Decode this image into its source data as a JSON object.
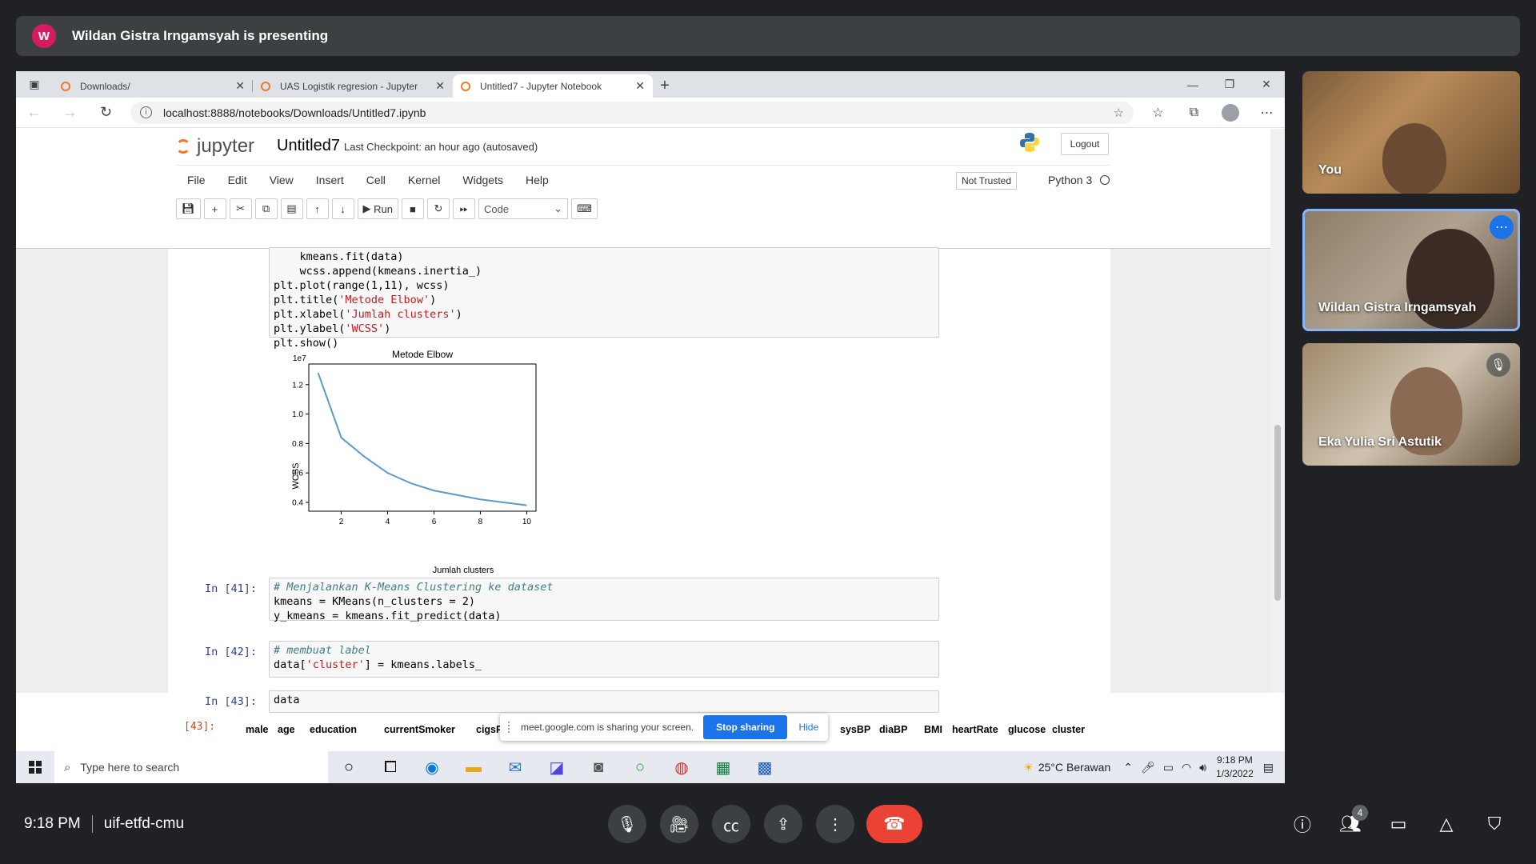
{
  "banner": {
    "avatar_letter": "W",
    "text": "Wildan Gistra Irngamsyah is presenting"
  },
  "browser": {
    "tabs": [
      {
        "label": "Downloads/"
      },
      {
        "label": "UAS Logistik regresion - Jupyter"
      },
      {
        "label": "Untitled7 - Jupyter Notebook"
      }
    ],
    "url": "localhost:8888/notebooks/Downloads/Untitled7.ipynb"
  },
  "jupyter": {
    "logo_text": "jupyter",
    "notebook_name": "Untitled7",
    "checkpoint_label": "Last Checkpoint:",
    "checkpoint_time": "an hour ago",
    "autosave": "(autosaved)",
    "logout": "Logout",
    "menu": [
      "File",
      "Edit",
      "View",
      "Insert",
      "Cell",
      "Kernel",
      "Widgets",
      "Help"
    ],
    "not_trusted": "Not Trusted",
    "kernel": "Python 3",
    "run_label": "Run",
    "cell_type": "Code"
  },
  "cells": {
    "c40_line1": "    kmeans.fit(data)",
    "c40_line2": "    wcss.append(kmeans.inertia_)",
    "c40_line3": "plt.plot(range(1,11), wcss)",
    "c40_line4_a": "plt.title(",
    "c40_line4_s": "'Metode Elbow'",
    "c40_line4_b": ")",
    "c40_line5_a": "plt.xlabel(",
    "c40_line5_s": "'Jumlah clusters'",
    "c40_line5_b": ")",
    "c40_line6_a": "plt.ylabel(",
    "c40_line6_s": "'WCSS'",
    "c40_line6_b": ")",
    "c40_line7": "plt.show()",
    "p41": "In [41]:",
    "c41_comment": "# Menjalankan K-Means Clustering ke dataset",
    "c41_line2": "kmeans = KMeans(n_clusters = 2)",
    "c41_line3": "y_kmeans = kmeans.fit_predict(data)",
    "p42": "In [42]:",
    "c42_comment": "# membuat label",
    "c42_line2_a": "data[",
    "c42_line2_s": "'cluster'",
    "c42_line2_b": "] = kmeans.labels_",
    "p43": "In [43]:",
    "c43_line1": "data",
    "out43": "[43]:"
  },
  "chart_data": {
    "type": "line",
    "title": "Metode Elbow",
    "xlabel": "Jumlah clusters",
    "ylabel": "WCSS",
    "offset_label": "1e7",
    "x": [
      1,
      2,
      3,
      4,
      5,
      6,
      7,
      8,
      9,
      10
    ],
    "y": [
      1.28,
      0.84,
      0.71,
      0.6,
      0.53,
      0.48,
      0.45,
      0.42,
      0.4,
      0.38
    ],
    "xlim": [
      0.6,
      10.4
    ],
    "ylim": [
      0.34,
      1.34
    ],
    "xticks": [
      "2",
      "4",
      "6",
      "8",
      "10"
    ],
    "yticks": [
      "0.4",
      "0.6",
      "0.8",
      "1.0",
      "1.2"
    ],
    "color": "#5b9bc8"
  },
  "table": {
    "columns_left": [
      "male",
      "age",
      "education",
      "currentSmoker",
      "cigsPe"
    ],
    "columns_right": [
      "sysBP",
      "diaBP",
      "BMI",
      "heartRate",
      "glucose",
      "cluster"
    ]
  },
  "share_popup": {
    "text": "meet.google.com is sharing your screen.",
    "stop": "Stop sharing",
    "hide": "Hide"
  },
  "taskbar": {
    "search_placeholder": "Type here to search",
    "weather": "25°C  Berawan",
    "time": "9:18 PM",
    "date": "1/3/2022"
  },
  "participants": [
    {
      "name": "You"
    },
    {
      "name": "Wildan Gistra Irngamsyah"
    },
    {
      "name": "Eka Yulia Sri Astutik"
    }
  ],
  "meet": {
    "time": "9:18 PM",
    "code": "uif-etfd-cmu",
    "people_count": "4"
  }
}
